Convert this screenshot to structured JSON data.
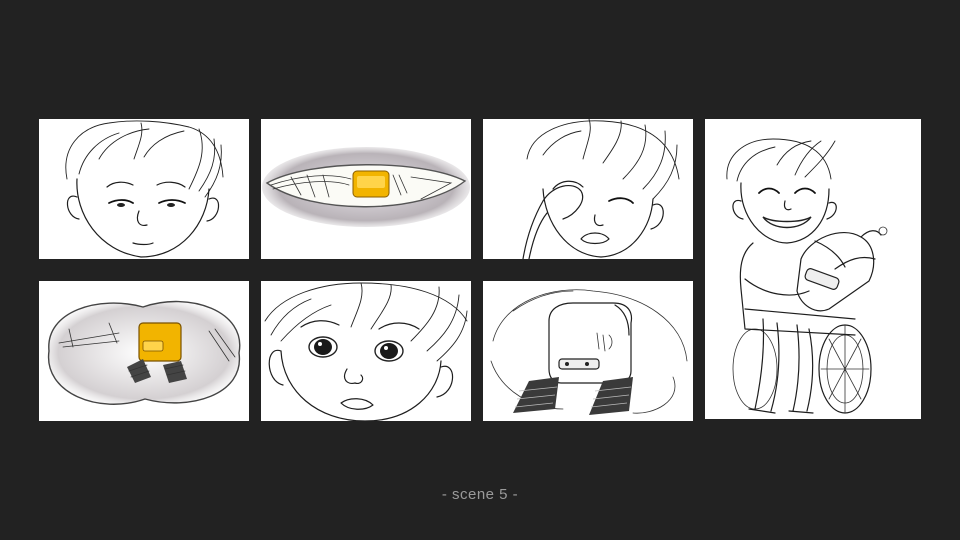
{
  "caption": "- scene 5 -",
  "colors": {
    "background": "#222222",
    "panel": "#ffffff",
    "caption": "#9a9a9a",
    "robot_accent": "#f2b400"
  },
  "panels": [
    {
      "id": "p1",
      "subject": "boy-face-sad"
    },
    {
      "id": "p2",
      "subject": "robot-through-eye-slit"
    },
    {
      "id": "p3",
      "subject": "boy-crying-rubbing-eye"
    },
    {
      "id": "p4",
      "subject": "robot-tracked-vision"
    },
    {
      "id": "p5",
      "subject": "boy-face-wide-eyes"
    },
    {
      "id": "p6",
      "subject": "robot-close-up"
    },
    {
      "id": "p7",
      "subject": "boy-hugging-robot-wheelchair"
    }
  ]
}
